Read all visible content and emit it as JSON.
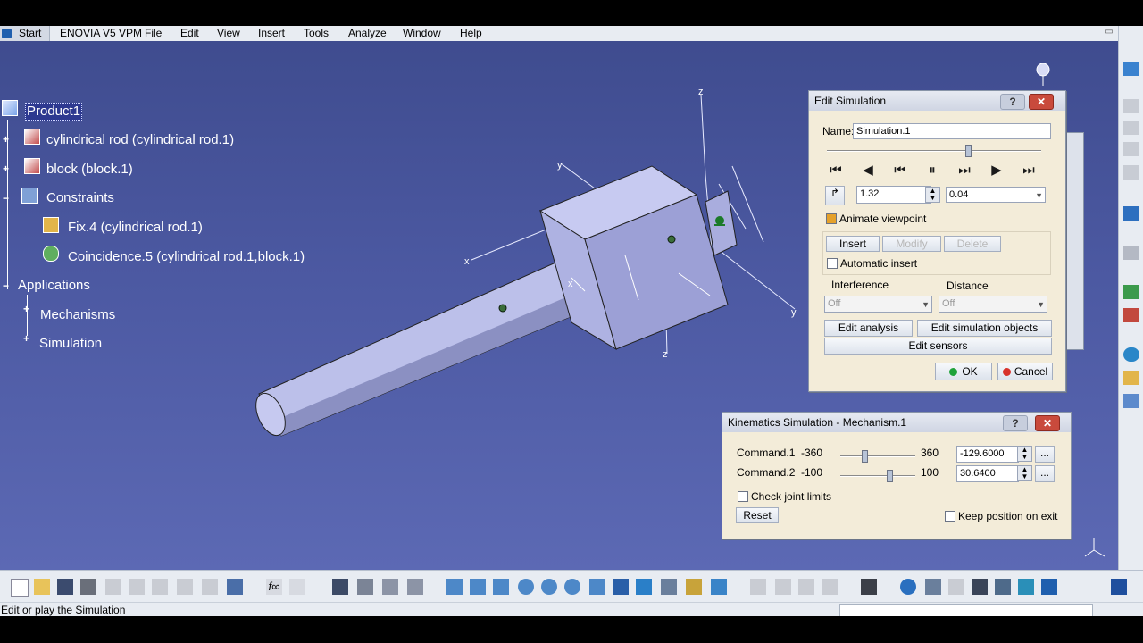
{
  "menubar": {
    "start": "Start",
    "items": [
      "ENOVIA V5 VPM",
      "File",
      "Edit",
      "View",
      "Insert",
      "Tools",
      "Analyze",
      "Window",
      "Help"
    ]
  },
  "tree": {
    "root": "Product1",
    "part1": "cylindrical rod (cylindrical rod.1)",
    "part2": "block (block.1)",
    "constraints": "Constraints",
    "fix": "Fix.4 (cylindrical rod.1)",
    "coincidence": "Coincidence.5 (cylindrical rod.1,block.1)",
    "applications": "Applications",
    "mechanisms": "Mechanisms",
    "simulation": "Simulation"
  },
  "axes": {
    "x": "x",
    "y": "y",
    "z": "z"
  },
  "edit_simulation": {
    "title": "Edit Simulation",
    "help": "?",
    "close": "✕",
    "name_label": "Name:",
    "name_value": "Simulation.1",
    "slider_pos": 0.66,
    "step_value": "1.32",
    "step_combo": "0.04",
    "animate_label": "Animate viewpoint",
    "animate_checked": true,
    "insert": "Insert",
    "modify": "Modify",
    "delete": "Delete",
    "auto_insert": "Automatic insert",
    "interference_label": "Interference",
    "interference_value": "Off",
    "distance_label": "Distance",
    "distance_value": "Off",
    "edit_analysis": "Edit analysis",
    "edit_sim_objects": "Edit simulation objects",
    "edit_sensors": "Edit sensors",
    "ok": "OK",
    "cancel": "Cancel"
  },
  "kinematics": {
    "title": "Kinematics Simulation - Mechanism.1",
    "help": "?",
    "close": "✕",
    "cmd1": {
      "label": "Command.1",
      "min": "-360",
      "max": "360",
      "value": "-129.6000",
      "pos": 0.32
    },
    "cmd2": {
      "label": "Command.2",
      "min": "-100",
      "max": "100",
      "value": "30.6400",
      "pos": 0.65
    },
    "more": "...",
    "check_limits": "Check joint limits",
    "reset": "Reset",
    "keep_pos": "Keep position on exit"
  },
  "status": {
    "text": "Edit or play the Simulation"
  },
  "colors": {
    "viewport": "#4c59a2",
    "dialog": "#f3ecd9",
    "part": "#bfc3ec"
  }
}
